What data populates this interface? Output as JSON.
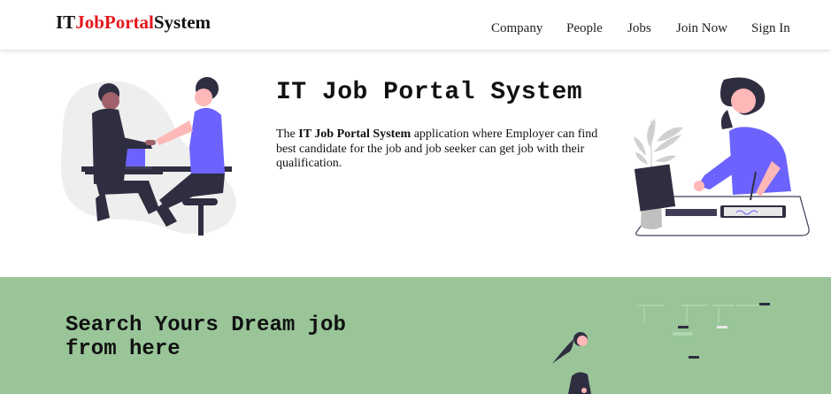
{
  "navbar": {
    "brand": {
      "part1": "IT",
      "part2": "JobPortal",
      "part3": "System"
    },
    "links": [
      {
        "label": "Company"
      },
      {
        "label": "People"
      },
      {
        "label": "Jobs"
      },
      {
        "label": "Join Now"
      },
      {
        "label": "Sign In"
      }
    ]
  },
  "hero": {
    "title": "IT Job Portal System",
    "desc_prefix": "The ",
    "desc_bold": "IT Job Portal System",
    "desc_rest": " application where Employer can find best candidate for the job and job seeker can get job with their qualification."
  },
  "search": {
    "title": "Search Yours Dream job from here"
  },
  "colors": {
    "brand_red": "#e5171c",
    "accent_purple": "#6c63ff",
    "section_green": "#99c598"
  },
  "icons": {
    "hero_left": "handshake-illustration",
    "hero_right": "person-with-tablet-illustration",
    "search": "job-search-illustration"
  }
}
